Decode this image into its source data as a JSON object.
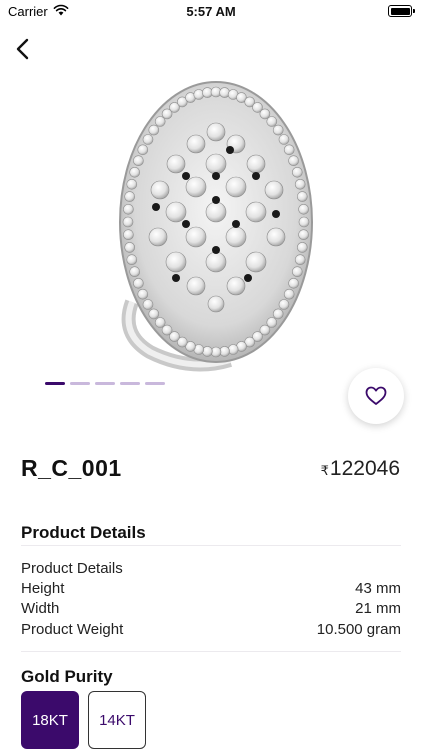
{
  "status": {
    "carrier": "Carrier",
    "time": "5:57 AM"
  },
  "product": {
    "name": "R_C_001",
    "currency": "₹",
    "price": "122046",
    "image_alt": "diamond-ring-image",
    "carousel": {
      "count": 5,
      "active": 0
    }
  },
  "details": {
    "section_title": "Product Details",
    "subheading": "Product Details",
    "rows": [
      {
        "label": "Height",
        "value": "43 mm"
      },
      {
        "label": "Width",
        "value": "21 mm"
      },
      {
        "label": "Product Weight",
        "value": "10.500 gram"
      }
    ]
  },
  "purity": {
    "section_title": "Gold Purity",
    "options": [
      "18KT",
      "14KT"
    ],
    "selected": "18KT"
  },
  "colors": {
    "accent": "#3b0a6b",
    "dot_inactive": "#c9b8dc"
  }
}
